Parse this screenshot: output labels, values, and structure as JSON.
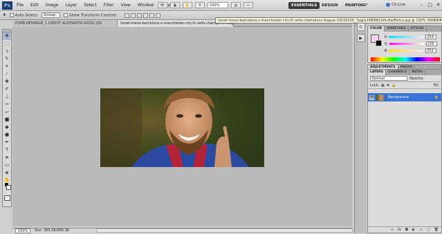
{
  "app": {
    "logo": "Ps",
    "menus": [
      "File",
      "Edit",
      "Image",
      "Layer",
      "Select",
      "Filter",
      "View",
      "Window",
      "Help"
    ],
    "zoom_menu": "100%"
  },
  "workspaces": {
    "active": "ESSENTIALS",
    "design": "DESIGN",
    "painting": "PAINTING",
    "more": "»"
  },
  "cs_live": "CS Live",
  "options": {
    "auto_select_label": "Auto-Select:",
    "auto_select_value": "Group",
    "transform_label": "Show Transform Controls"
  },
  "tooltip": "lionel-messi-barcelona-v-manchester-city-fc-uefa-champions-league-19102016_7pgjly18898j1b0luflwfffyfuy.jpg @ 100% (RGB/8#)",
  "doc_tabs": [
    "POME.RESMAGE_1 CREDIT AUSTRASTA-SIDOLI.JPG",
    "lionel-messi-barcelona-v-manchester-city-fc-uefa-champions-league-19102016..7pgjly18898j1b0luflwfffyfuy.jpg"
  ],
  "status": {
    "zoom": "100%",
    "doc": "Doc: 365.3K/365.3K"
  },
  "color_panel": {
    "tabs": [
      "COLOR",
      "SWATCHES",
      "STYLES"
    ],
    "r": "254",
    "g": "226",
    "b": "251",
    "r_label": "R",
    "g_label": "G",
    "b_label": "B"
  },
  "adjust_tabs": [
    "ADJUSTMENTS",
    "MASKS"
  ],
  "layers_panel": {
    "tabs": [
      "LAYERS",
      "CHANNELS",
      "PATHS"
    ],
    "blend_mode": "Normal",
    "opacity_label": "Opacity:",
    "lock_label": "Lock:",
    "fill_label": "Fill:",
    "layer_name": "Background"
  },
  "colors": {
    "accent": "#3875d7",
    "foreground": "#f7d3f2"
  }
}
